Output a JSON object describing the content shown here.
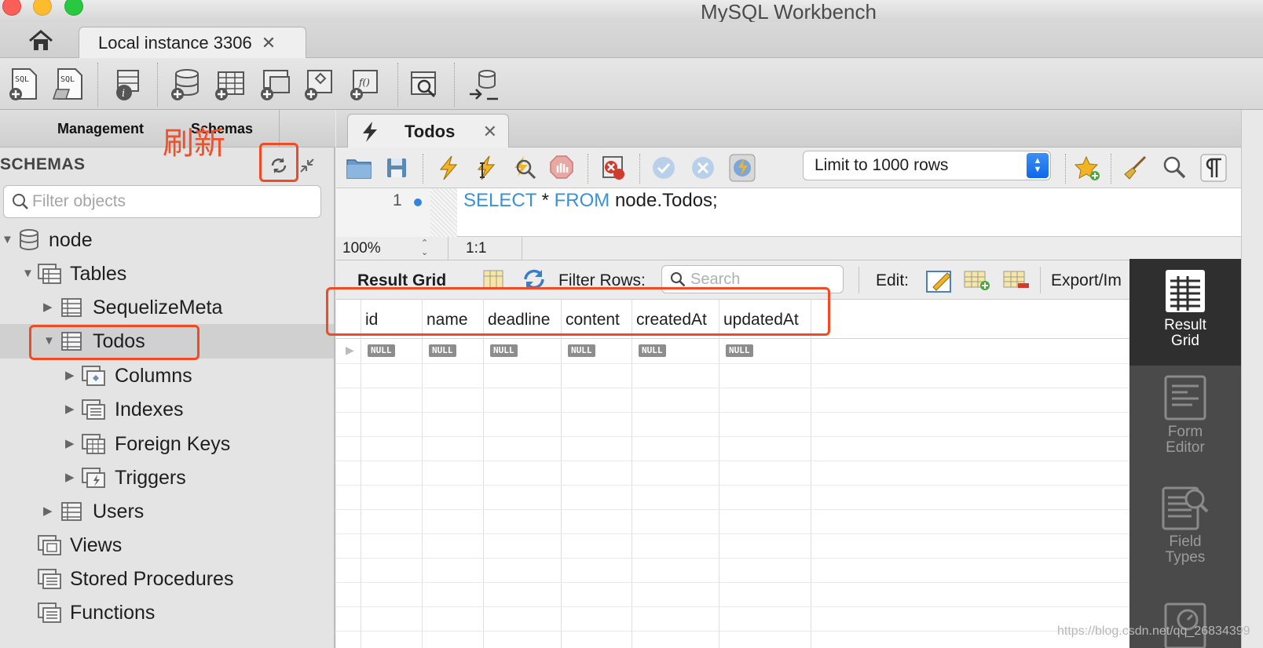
{
  "window": {
    "title": "MySQL Workbench"
  },
  "connection_tab": {
    "label": "Local instance 3306",
    "close": "✕"
  },
  "sidebar": {
    "tabs": [
      "Management",
      "Schemas"
    ],
    "heading": "SCHEMAS",
    "annotation": "刷新",
    "filter_placeholder": "Filter objects",
    "tree": {
      "schema": "node",
      "tables_group": "Tables",
      "tables": [
        "SequelizeMeta",
        "Todos",
        "Users"
      ],
      "todos_children": [
        "Columns",
        "Indexes",
        "Foreign Keys",
        "Triggers"
      ],
      "groups": [
        "Views",
        "Stored Procedures",
        "Functions"
      ]
    }
  },
  "query_tab": {
    "label": "Todos",
    "close": "✕"
  },
  "editor": {
    "limit_option": "Limit to 1000 rows",
    "line_number": "1",
    "sql": {
      "kw1": "SELECT",
      "mid": " * ",
      "kw2": "FROM",
      "rest": " node.Todos;"
    },
    "zoom": "100%",
    "cursor": "1:1"
  },
  "result": {
    "tab_label": "Result Grid",
    "filter_label": "Filter Rows:",
    "search_placeholder": "Search",
    "edit_label": "Edit:",
    "export_label": "Export/Im",
    "columns": [
      "id",
      "name",
      "deadline",
      "content",
      "createdAt",
      "updatedAt"
    ],
    "rows": [
      [
        "NULL",
        "NULL",
        "NULL",
        "NULL",
        "NULL",
        "NULL"
      ]
    ]
  },
  "side_panel": {
    "items": [
      {
        "line1": "Result",
        "line2": "Grid"
      },
      {
        "line1": "Form",
        "line2": "Editor"
      },
      {
        "line1": "Field",
        "line2": "Types"
      }
    ]
  },
  "watermark": "https://blog.csdn.net/qq_26834399",
  "colors": {
    "annotation": "#ef4b24",
    "keyword": "#3a92d6",
    "select_accent": "#1068e6"
  }
}
